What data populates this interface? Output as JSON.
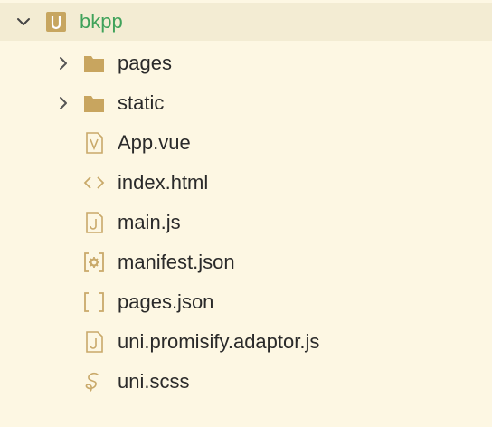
{
  "explorer": {
    "project": {
      "name": "bkpp",
      "icon": "uni-project-icon",
      "expanded": true
    },
    "items": [
      {
        "label": "pages",
        "type": "folder",
        "icon": "folder-icon",
        "expanded": false
      },
      {
        "label": "static",
        "type": "folder",
        "icon": "folder-icon",
        "expanded": false
      },
      {
        "label": "App.vue",
        "type": "file",
        "icon": "vue-file-icon"
      },
      {
        "label": "index.html",
        "type": "file",
        "icon": "html-file-icon"
      },
      {
        "label": "main.js",
        "type": "file",
        "icon": "js-file-icon"
      },
      {
        "label": "manifest.json",
        "type": "file",
        "icon": "manifest-file-icon"
      },
      {
        "label": "pages.json",
        "type": "file",
        "icon": "json-file-icon"
      },
      {
        "label": "uni.promisify.adaptor.js",
        "type": "file",
        "icon": "js-file-icon"
      },
      {
        "label": "uni.scss",
        "type": "file",
        "icon": "scss-file-icon"
      }
    ]
  },
  "colors": {
    "background": "#fdf7e3",
    "selected_row": "#f3ecd3",
    "project_name": "#3fa25a",
    "icon": "#c9a96a",
    "folder": "#c8a55f",
    "chevron": "#555555",
    "text": "#2a2a2a"
  }
}
